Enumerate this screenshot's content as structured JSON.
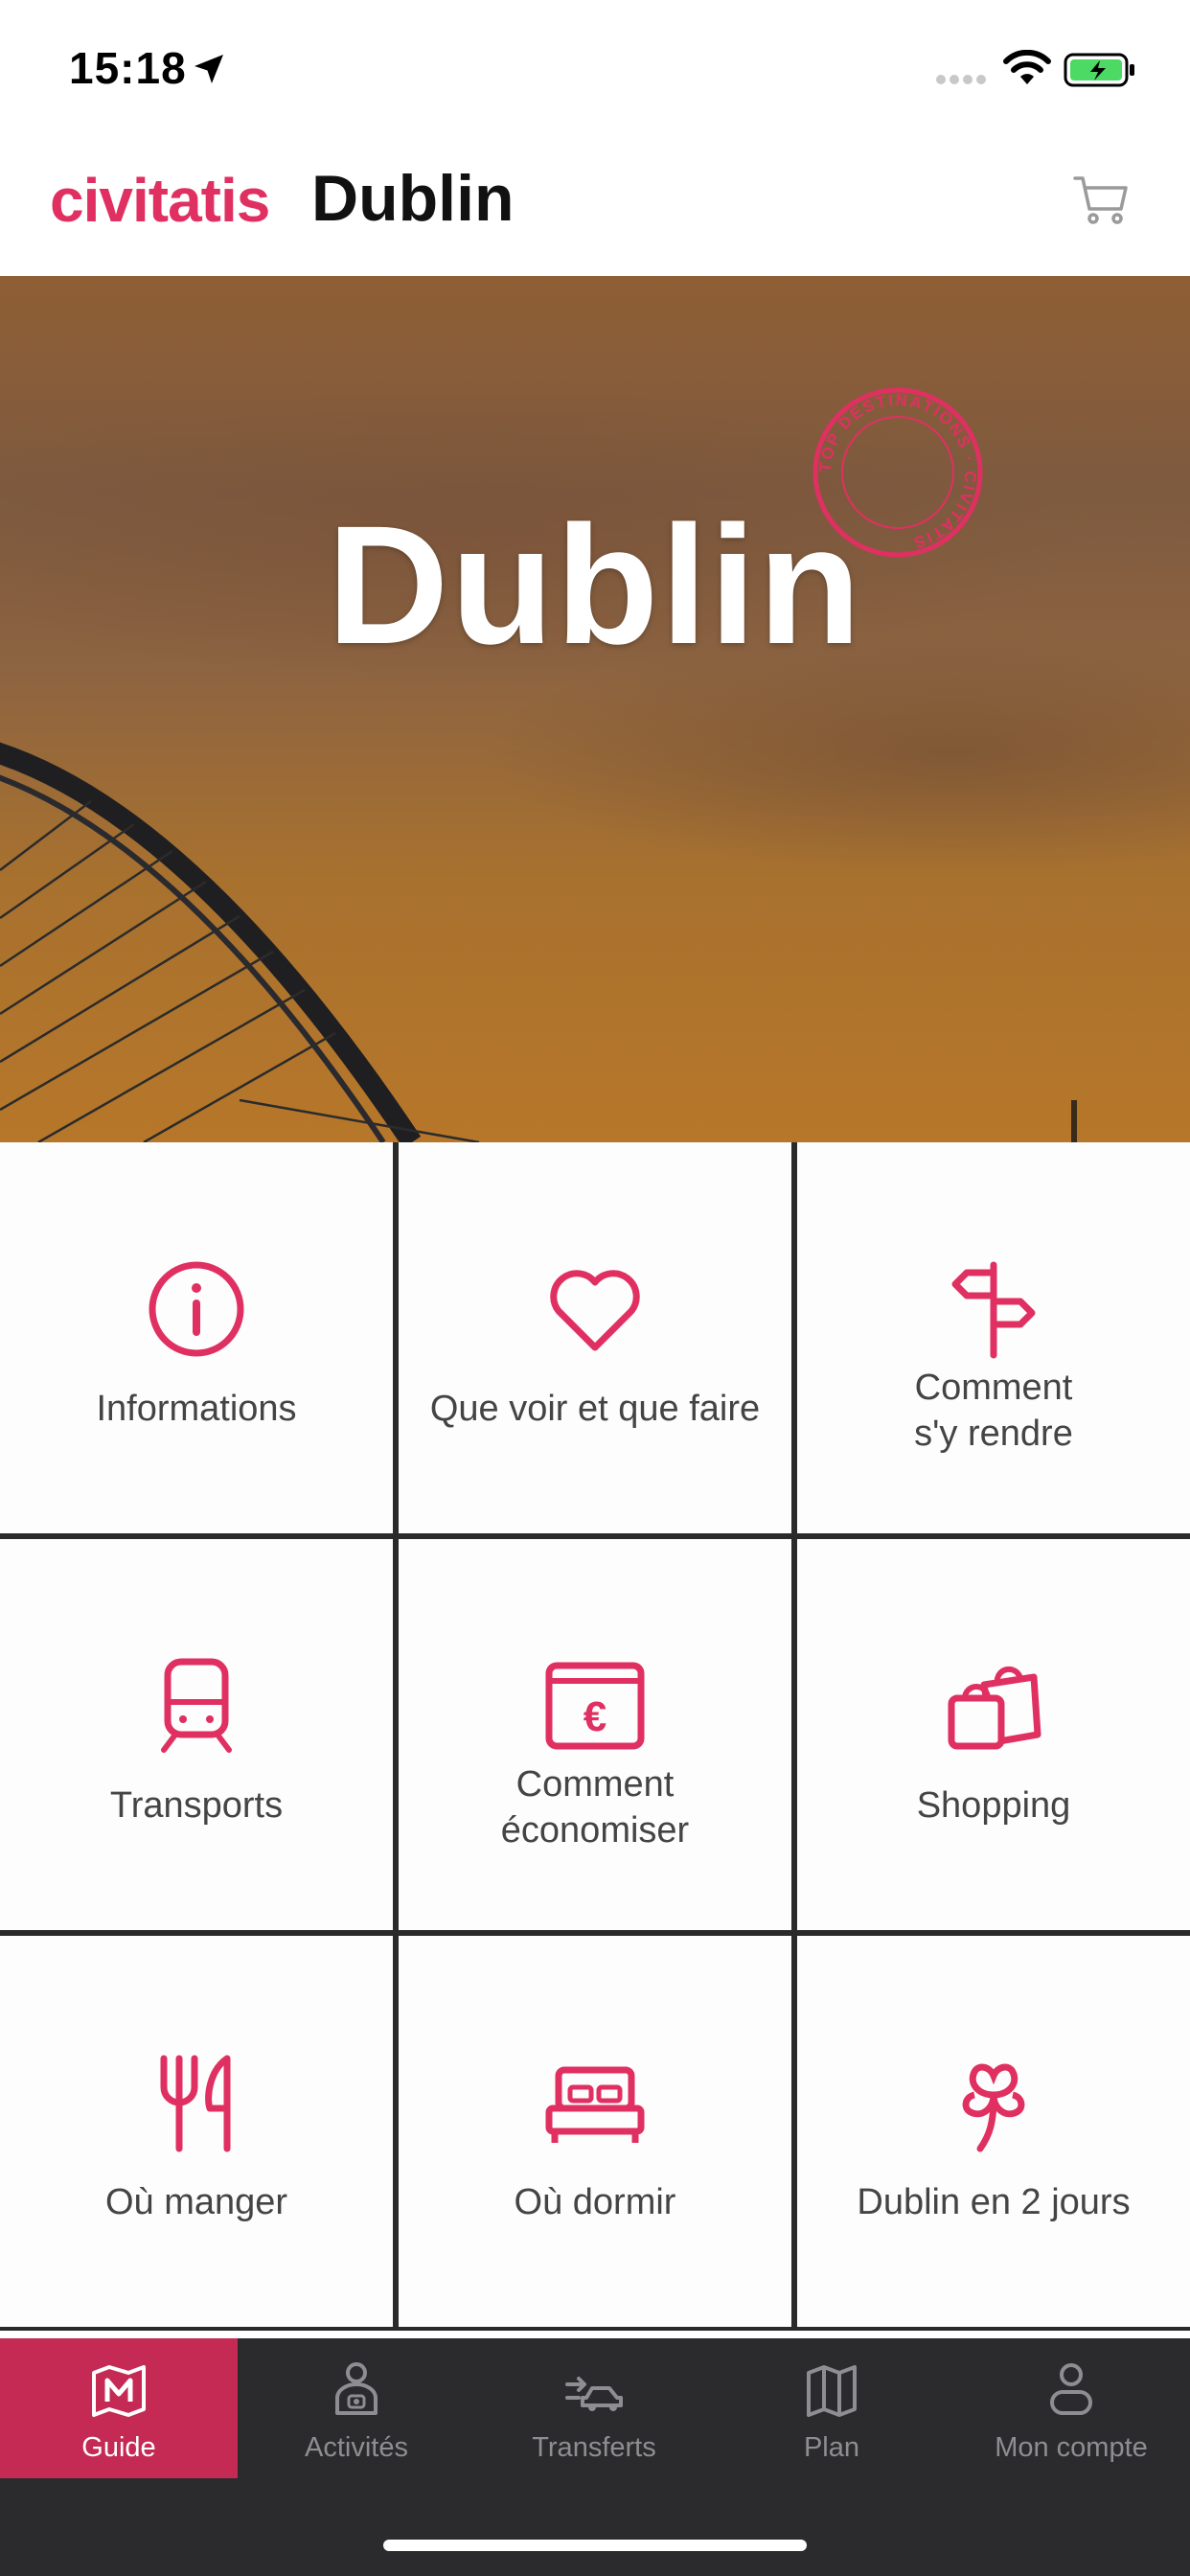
{
  "status_bar": {
    "time": "15:18"
  },
  "header": {
    "brand": "civitatis",
    "city": "Dublin",
    "cart_icon": "cart-icon"
  },
  "hero": {
    "title": "Dublin",
    "stamp_text": "TOP DESTINATIONS · CIVITATIS"
  },
  "colors": {
    "accent": "#e03061",
    "tab_active": "#c42a53",
    "tabbar_bg": "#2b2b2d"
  },
  "menu": [
    {
      "label": "Informations",
      "icon": "info-icon"
    },
    {
      "label": "Que voir et que faire",
      "icon": "heart-icon"
    },
    {
      "label": "Comment\ns'y rendre",
      "icon": "signpost-icon"
    },
    {
      "label": "Transports",
      "icon": "train-icon"
    },
    {
      "label": "Comment\néconomiser",
      "icon": "euro-wallet-icon"
    },
    {
      "label": "Shopping",
      "icon": "shopping-bags-icon"
    },
    {
      "label": "Où manger",
      "icon": "fork-knife-icon"
    },
    {
      "label": "Où dormir",
      "icon": "bed-icon"
    },
    {
      "label": "Dublin en 2 jours",
      "icon": "clover-icon"
    }
  ],
  "tabs": [
    {
      "label": "Guide",
      "icon": "map-icon",
      "active": true
    },
    {
      "label": "Activités",
      "icon": "guide-person-icon",
      "active": false
    },
    {
      "label": "Transferts",
      "icon": "transfer-car-icon",
      "active": false
    },
    {
      "label": "Plan",
      "icon": "folded-map-icon",
      "active": false
    },
    {
      "label": "Mon compte",
      "icon": "user-icon",
      "active": false
    }
  ]
}
